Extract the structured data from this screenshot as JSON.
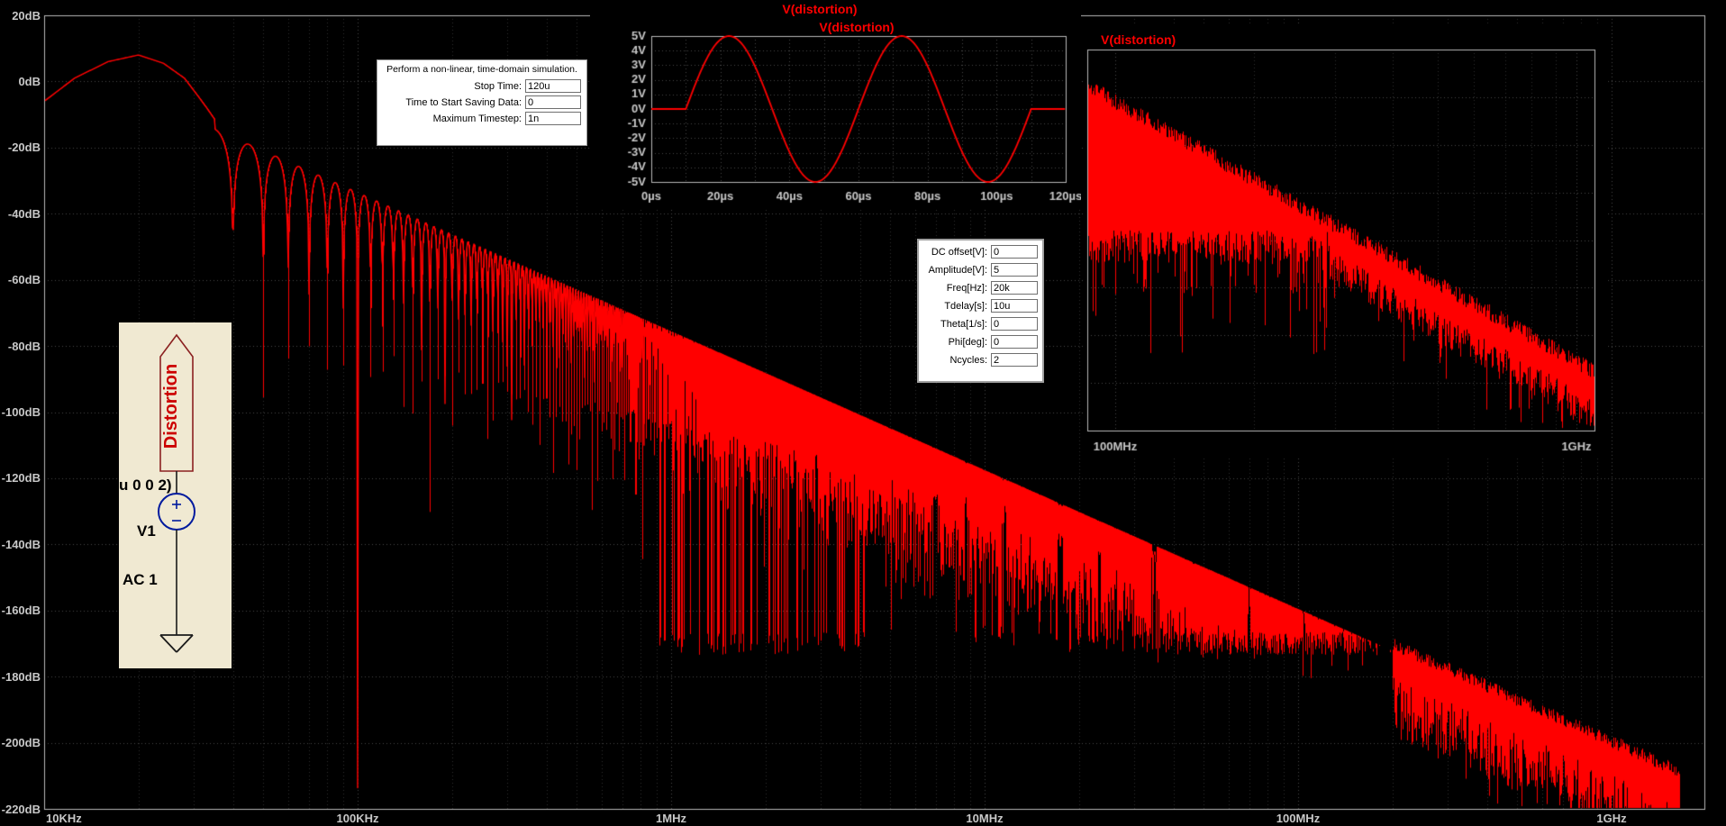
{
  "app": {
    "name": "LTspice waveform viewer with schematic and simulation dialogs",
    "background": "#000000"
  },
  "colors": {
    "trace": "#ff0000",
    "grid_major": "#484848",
    "grid_minor": "#2f2f2f",
    "frame": "#b9b9b9",
    "tick_text": "#c8c8c8",
    "title": "#ff0000",
    "dialog_bg": "#ffffff",
    "schematic_bg": "#f0e9d2",
    "component": "#001a9e",
    "net_flag": "#8b2020",
    "net_text": "#cc0000"
  },
  "chart_data": [
    {
      "type": "line",
      "title": "V(distortion)",
      "subtitle": "FFT magnitude of output, log frequency axis",
      "x_ticks": [
        "10KHz",
        "100KHz",
        "1MHz",
        "10MHz",
        "100MHz",
        "1GHz"
      ],
      "y_ticks": [
        "20dB",
        "0dB",
        "-20dB",
        "-40dB",
        "-60dB",
        "-80dB",
        "-100dB",
        "-120dB",
        "-140dB",
        "-160dB",
        "-180dB",
        "-200dB",
        "-220dB"
      ],
      "x_log_range_hz": [
        10000,
        2000000000
      ],
      "y_range_db": [
        -220,
        20
      ],
      "grid": true,
      "legend_position": "top-center",
      "fundamental_hz": 20000,
      "peak_db": 8,
      "null_spacing_hz": 10000,
      "sidelobe_ref": {
        "freq_hz": 53000,
        "db": -22
      },
      "envelope_slope_db_per_decade": -42,
      "noise_floor_db": -170,
      "main_lobe_points_hz_db": [
        [
          10000,
          -6
        ],
        [
          12500,
          1
        ],
        [
          16000,
          6
        ],
        [
          20000,
          8
        ],
        [
          24000,
          5.5
        ],
        [
          28000,
          1
        ],
        [
          31000,
          -4.5
        ],
        [
          33000,
          -8
        ],
        [
          35000,
          -11.5
        ]
      ],
      "trace_color": "#ff0000"
    },
    {
      "type": "line",
      "title": "V(distortion)",
      "subtitle": "time-domain 2-cycle 20kHz sine burst",
      "x_ticks": [
        "0µs",
        "20µs",
        "40µs",
        "60µs",
        "80µs",
        "100µs",
        "120µs"
      ],
      "y_ticks": [
        "5V",
        "4V",
        "3V",
        "2V",
        "1V",
        "0V",
        "-1V",
        "-2V",
        "-3V",
        "-4V",
        "-5V"
      ],
      "x_range_us": [
        0,
        120
      ],
      "y_range_v": [
        -5,
        5
      ],
      "grid": true,
      "signal": {
        "amplitude_v": 5,
        "freq_hz": 20000,
        "tdelay_us": 10,
        "ncycles": 2
      },
      "trace_color": "#ff0000"
    },
    {
      "type": "line",
      "title": "V(distortion)",
      "subtitle": "FFT zoom 100MHz-1GHz noisy band",
      "x_ticks": [
        "100MHz",
        "1GHz"
      ],
      "x_log_range_hz": [
        87000000,
        1100000000
      ],
      "grid": true,
      "band": {
        "env_ref_hz": 87000000,
        "env_start_db": -158,
        "env_end_db": -202,
        "slope_db_per_decade": -40,
        "floor_db": -179,
        "spike_db": -196
      },
      "trace_color": "#ff0000"
    }
  ],
  "sim_dialog": {
    "heading": "Perform a non-linear, time-domain simulation.",
    "fields": [
      {
        "name": "stop-time",
        "label": "Stop Time:",
        "value": "120u"
      },
      {
        "name": "time-to-start-saving",
        "label": "Time to Start Saving Data:",
        "value": "0"
      },
      {
        "name": "maximum-timestep",
        "label": "Maximum Timestep:",
        "value": "1n"
      }
    ]
  },
  "source_dialog": {
    "fields": [
      {
        "name": "dc-offset",
        "label": "DC offset[V]:",
        "value": "0"
      },
      {
        "name": "amplitude",
        "label": "Amplitude[V]:",
        "value": "5"
      },
      {
        "name": "freq",
        "label": "Freq[Hz]:",
        "value": "20k"
      },
      {
        "name": "tdelay",
        "label": "Tdelay[s]:",
        "value": "10u"
      },
      {
        "name": "theta",
        "label": "Theta[1/s]:",
        "value": "0"
      },
      {
        "name": "phi",
        "label": "Phi[deg]:",
        "value": "0"
      },
      {
        "name": "ncycles",
        "label": "Ncycles:",
        "value": "2"
      }
    ]
  },
  "schematic": {
    "net_label": "Distortion",
    "directive_fragment": "u 0 0 2)",
    "designator": "V1",
    "ac_spec": "AC 1"
  }
}
